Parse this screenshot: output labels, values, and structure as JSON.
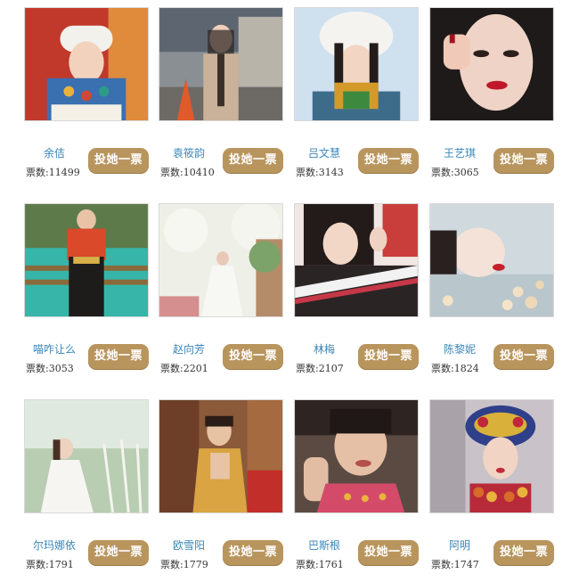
{
  "button_label": "投她一票",
  "votes_prefix": "票数:",
  "accent_color": "#b9955e",
  "name_color": "#3a86b8",
  "contestants": [
    {
      "name": "余佶",
      "votes": "11499"
    },
    {
      "name": "袁筱韵",
      "votes": "10410"
    },
    {
      "name": "吕文慧",
      "votes": "3143"
    },
    {
      "name": "王艺琪",
      "votes": "3065"
    },
    {
      "name": "喵咋让么",
      "votes": "3053"
    },
    {
      "name": "赵向芳",
      "votes": "2201"
    },
    {
      "name": "林梅",
      "votes": "2107"
    },
    {
      "name": "陈黎妮",
      "votes": "1824"
    },
    {
      "name": "尔玛娜依",
      "votes": "1791"
    },
    {
      "name": "欧雪阳",
      "votes": "1779"
    },
    {
      "name": "巴斯根",
      "votes": "1761"
    },
    {
      "name": "阿明",
      "votes": "1747"
    }
  ]
}
